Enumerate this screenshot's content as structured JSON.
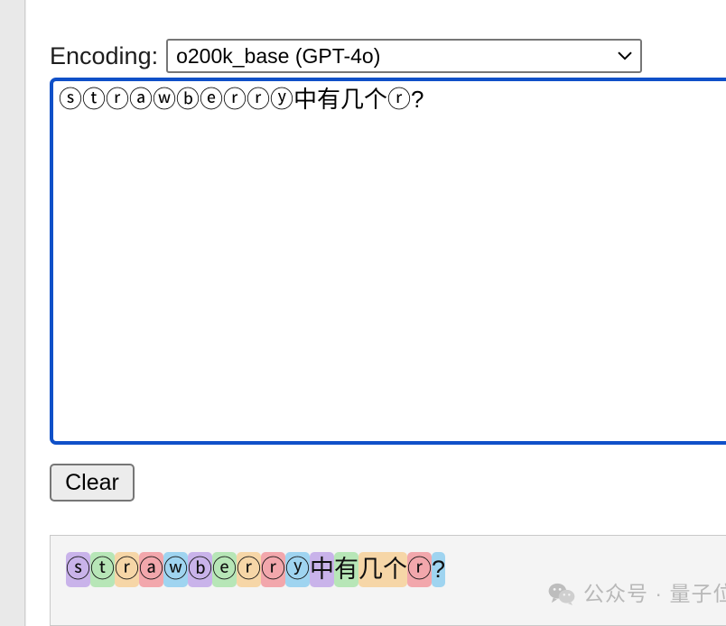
{
  "encoding": {
    "label": "Encoding:",
    "selected": "o200k_base (GPT-4o)",
    "chevron_icon": "chevron-down-icon"
  },
  "input": {
    "value": "ⓢⓣⓡⓐⓦⓑⓔⓡⓡⓨ中有几个ⓡ?",
    "placeholder": ""
  },
  "actions": {
    "clear_label": "Clear"
  },
  "tokens": {
    "colors": [
      "#c9b3ea",
      "#b7e6b7",
      "#f6d6a7",
      "#f2a7ac",
      "#9fd4f0"
    ],
    "items": [
      {
        "text": "ⓢ",
        "color": "#c9b3ea"
      },
      {
        "text": "ⓣ",
        "color": "#b7e6b7"
      },
      {
        "text": "ⓡ",
        "color": "#f6d6a7"
      },
      {
        "text": "ⓐ",
        "color": "#f2a7ac"
      },
      {
        "text": "ⓦ",
        "color": "#9fd4f0"
      },
      {
        "text": "ⓑ",
        "color": "#c9b3ea"
      },
      {
        "text": "ⓔ",
        "color": "#b7e6b7"
      },
      {
        "text": "ⓡ",
        "color": "#f6d6a7"
      },
      {
        "text": "ⓡ",
        "color": "#f2a7ac"
      },
      {
        "text": "ⓨ",
        "color": "#9fd4f0"
      },
      {
        "text": "中",
        "color": "#c9b3ea"
      },
      {
        "text": "有",
        "color": "#b7e6b7"
      },
      {
        "text": "几个",
        "color": "#f6d6a7"
      },
      {
        "text": "ⓡ",
        "color": "#f2a7ac"
      },
      {
        "text": "?",
        "color": "#9fd4f0"
      }
    ]
  },
  "watermark": {
    "icon": "wechat-icon",
    "text": "公众号 · 量子位"
  },
  "theme": {
    "focus_border": "#1050c8",
    "panel_background": "#f4f4f4",
    "page_background": "#ffffff"
  }
}
